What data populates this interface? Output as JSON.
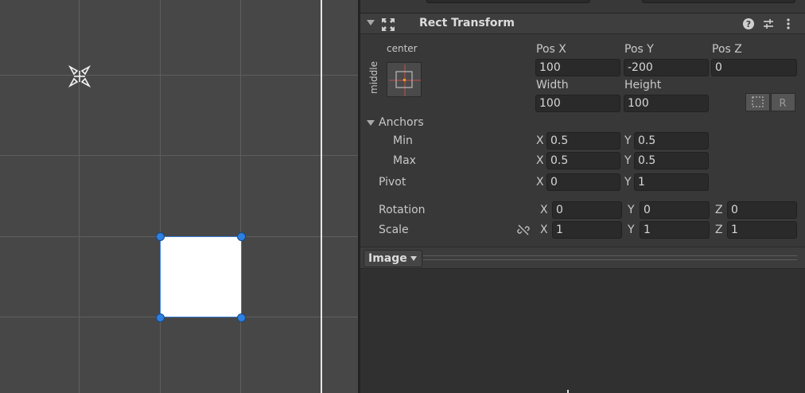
{
  "inspector": {
    "component": {
      "title": "Rect Transform",
      "icon": "rect-transform-icon",
      "header_icons": [
        "help-icon",
        "presets-icon",
        "kebab-menu-icon"
      ]
    },
    "anchor_preset": {
      "horizontal": "center",
      "vertical": "middle"
    },
    "position": {
      "pos_x_label": "Pos X",
      "pos_x": "100",
      "pos_y_label": "Pos Y",
      "pos_y": "-200",
      "pos_z_label": "Pos Z",
      "pos_z": "0"
    },
    "size": {
      "width_label": "Width",
      "width": "100",
      "height_label": "Height",
      "height": "100"
    },
    "anchors": {
      "label": "Anchors",
      "min_label": "Min",
      "min_x": "0.5",
      "min_y": "0.5",
      "max_label": "Max",
      "max_x": "0.5",
      "max_y": "0.5"
    },
    "pivot": {
      "label": "Pivot",
      "x": "0",
      "y": "1"
    },
    "rotation": {
      "label": "Rotation",
      "x": "0",
      "y": "0",
      "z": "0"
    },
    "scale": {
      "label": "Scale",
      "x": "1",
      "y": "1",
      "z": "1"
    },
    "axis": {
      "x": "X",
      "y": "Y",
      "z": "Z"
    },
    "next_component": {
      "title": "Image"
    }
  },
  "colors": {
    "scene_bg": "#474747",
    "inspector_bg": "#383838",
    "field_bg": "#2a2a2a",
    "handle_blue": "#2f7fe0",
    "anchor_orange": "#f0a020"
  }
}
